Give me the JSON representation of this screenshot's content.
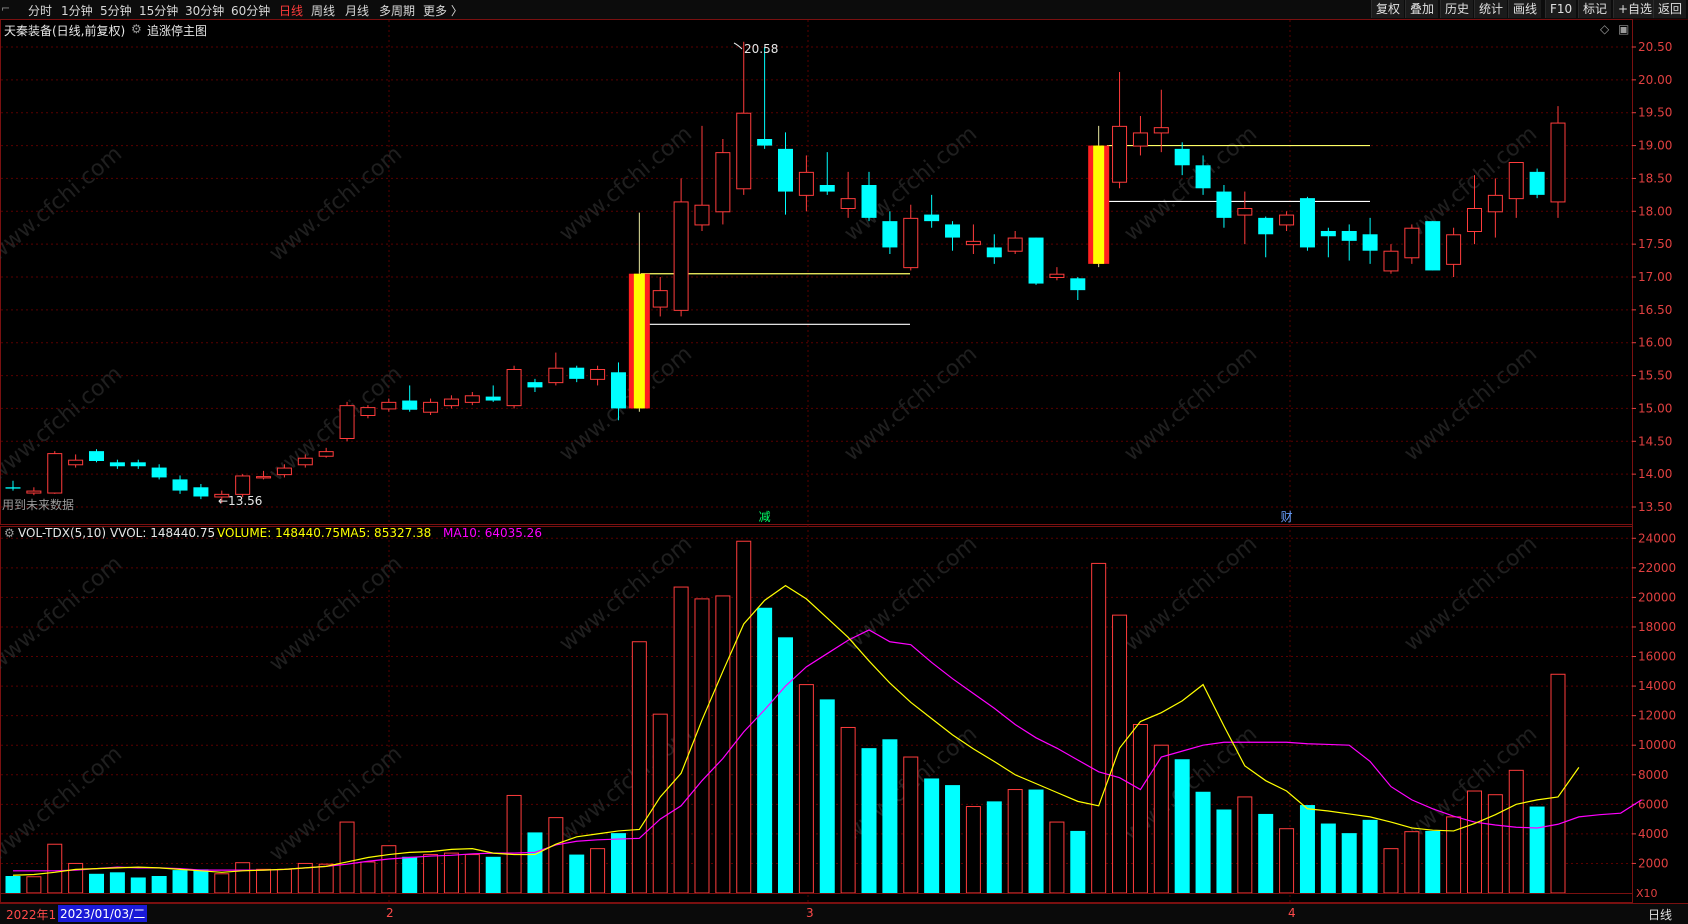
{
  "toolbar": {
    "period_tabs": [
      {
        "label": "分时",
        "active": false
      },
      {
        "label": "1分钟",
        "active": false
      },
      {
        "label": "5分钟",
        "active": false
      },
      {
        "label": "15分钟",
        "active": false
      },
      {
        "label": "30分钟",
        "active": false
      },
      {
        "label": "60分钟",
        "active": false
      },
      {
        "label": "日线",
        "active": true
      },
      {
        "label": "周线",
        "active": false
      },
      {
        "label": "月线",
        "active": false
      },
      {
        "label": "多周期",
        "active": false
      },
      {
        "label": "更多 〉",
        "active": false
      }
    ],
    "right_buttons": [
      "复权",
      "叠加",
      "历史",
      "统计",
      "画线",
      "F10",
      "标记",
      "+自选",
      "返回"
    ]
  },
  "main_chart": {
    "stock_title": "天秦装备(日线,前复权)",
    "indicator_label": "追涨停主图",
    "high_annotation": "20.58",
    "low_annotation": "←13.56",
    "future_data_note": "用到未来数据",
    "event_markers": [
      {
        "text": "减",
        "date_index": 36
      },
      {
        "text": "财",
        "date_index": 61
      }
    ],
    "price_axis_ticks": [
      "20.50",
      "20.00",
      "19.50",
      "19.00",
      "18.50",
      "18.00",
      "17.50",
      "17.00",
      "16.50",
      "16.00",
      "15.50",
      "15.00",
      "14.50",
      "14.00",
      "13.50"
    ]
  },
  "volume_chart": {
    "title": "VOL-TDX(5,10)",
    "vvol": "VVOL: 148440.75",
    "volume": "VOLUME: 148440.75",
    "ma5": "MA5: 85327.38",
    "ma10": "MA10: 64035.26",
    "axis_ticks": [
      "24000",
      "22000",
      "20000",
      "18000",
      "16000",
      "14000",
      "12000",
      "10000",
      "8000",
      "6000",
      "4000",
      "2000"
    ],
    "unit_label": "X10"
  },
  "watermark": "www.cfchi.com",
  "colors": {
    "up": "#ff3c3c",
    "down": "#00ffff",
    "limit_up_fill": "#ffff00",
    "ma5": "#ffff00",
    "ma10": "#ff00ff",
    "grid": "#5a0000",
    "level_yellow": "#ffff66",
    "level_white": "#ffffff"
  },
  "bottom_bar": {
    "left_date": "2022年1",
    "selected_date": "2023/01/03/二",
    "month_labels": [
      "2",
      "3",
      "4"
    ],
    "period_label": "日线"
  },
  "chart_data": {
    "type": "candlestick",
    "price_ylim": [
      13.3,
      20.7
    ],
    "candles": [
      {
        "o": 13.8,
        "h": 13.9,
        "l": 13.75,
        "c": 13.78
      },
      {
        "o": 13.72,
        "h": 13.8,
        "l": 13.68,
        "c": 13.75
      },
      {
        "o": 13.72,
        "h": 14.35,
        "l": 13.7,
        "c": 14.32
      },
      {
        "o": 14.15,
        "h": 14.3,
        "l": 14.1,
        "c": 14.22
      },
      {
        "o": 14.35,
        "h": 14.38,
        "l": 14.18,
        "c": 14.2
      },
      {
        "o": 14.18,
        "h": 14.22,
        "l": 14.08,
        "c": 14.12
      },
      {
        "o": 14.18,
        "h": 14.22,
        "l": 14.08,
        "c": 14.12
      },
      {
        "o": 14.1,
        "h": 14.15,
        "l": 13.92,
        "c": 13.95
      },
      {
        "o": 13.92,
        "h": 13.98,
        "l": 13.7,
        "c": 13.75
      },
      {
        "o": 13.8,
        "h": 13.85,
        "l": 13.62,
        "c": 13.66
      },
      {
        "o": 13.66,
        "h": 13.75,
        "l": 13.56,
        "c": 13.7
      },
      {
        "o": 13.7,
        "h": 14.0,
        "l": 13.65,
        "c": 13.98
      },
      {
        "o": 13.95,
        "h": 14.05,
        "l": 13.92,
        "c": 13.97
      },
      {
        "o": 14.0,
        "h": 14.15,
        "l": 13.95,
        "c": 14.1
      },
      {
        "o": 14.15,
        "h": 14.3,
        "l": 14.1,
        "c": 14.25
      },
      {
        "o": 14.28,
        "h": 14.4,
        "l": 14.25,
        "c": 14.35
      },
      {
        "o": 14.55,
        "h": 15.1,
        "l": 14.5,
        "c": 15.05
      },
      {
        "o": 14.9,
        "h": 15.05,
        "l": 14.85,
        "c": 15.02
      },
      {
        "o": 15.0,
        "h": 15.15,
        "l": 14.95,
        "c": 15.1
      },
      {
        "o": 15.12,
        "h": 15.35,
        "l": 14.95,
        "c": 14.98
      },
      {
        "o": 14.95,
        "h": 15.15,
        "l": 14.9,
        "c": 15.1
      },
      {
        "o": 15.05,
        "h": 15.2,
        "l": 15.0,
        "c": 15.15
      },
      {
        "o": 15.1,
        "h": 15.25,
        "l": 15.05,
        "c": 15.2
      },
      {
        "o": 15.18,
        "h": 15.35,
        "l": 15.1,
        "c": 15.12
      },
      {
        "o": 15.05,
        "h": 15.65,
        "l": 15.0,
        "c": 15.6
      },
      {
        "o": 15.4,
        "h": 15.45,
        "l": 15.25,
        "c": 15.32
      },
      {
        "o": 15.4,
        "h": 15.85,
        "l": 15.35,
        "c": 15.62
      },
      {
        "o": 15.62,
        "h": 15.65,
        "l": 15.4,
        "c": 15.45
      },
      {
        "o": 15.45,
        "h": 15.65,
        "l": 15.35,
        "c": 15.6
      },
      {
        "o": 15.55,
        "h": 15.7,
        "l": 14.82,
        "c": 15.0
      },
      {
        "o": 15.0,
        "h": 17.98,
        "l": 14.95,
        "c": 17.05,
        "limit": true
      },
      {
        "o": 16.55,
        "h": 17.0,
        "l": 16.4,
        "c": 16.8
      },
      {
        "o": 16.5,
        "h": 18.5,
        "l": 16.4,
        "c": 18.15
      },
      {
        "o": 17.8,
        "h": 19.3,
        "l": 17.7,
        "c": 18.1
      },
      {
        "o": 18.0,
        "h": 19.1,
        "l": 17.8,
        "c": 18.9
      },
      {
        "o": 18.35,
        "h": 20.58,
        "l": 18.25,
        "c": 19.5
      },
      {
        "o": 19.1,
        "h": 20.5,
        "l": 18.95,
        "c": 19.0
      },
      {
        "o": 18.95,
        "h": 19.2,
        "l": 17.95,
        "c": 18.3
      },
      {
        "o": 18.25,
        "h": 18.85,
        "l": 18.0,
        "c": 18.6
      },
      {
        "o": 18.4,
        "h": 18.9,
        "l": 18.25,
        "c": 18.3
      },
      {
        "o": 18.05,
        "h": 18.6,
        "l": 17.9,
        "c": 18.2
      },
      {
        "o": 18.4,
        "h": 18.6,
        "l": 17.85,
        "c": 17.9
      },
      {
        "o": 17.85,
        "h": 18.0,
        "l": 17.35,
        "c": 17.45
      },
      {
        "o": 17.15,
        "h": 18.1,
        "l": 17.1,
        "c": 17.9
      },
      {
        "o": 17.95,
        "h": 18.25,
        "l": 17.75,
        "c": 17.85
      },
      {
        "o": 17.8,
        "h": 17.85,
        "l": 17.4,
        "c": 17.6
      },
      {
        "o": 17.5,
        "h": 17.8,
        "l": 17.35,
        "c": 17.55
      },
      {
        "o": 17.45,
        "h": 17.65,
        "l": 17.2,
        "c": 17.3
      },
      {
        "o": 17.4,
        "h": 17.7,
        "l": 17.35,
        "c": 17.6
      },
      {
        "o": 17.6,
        "h": 17.6,
        "l": 16.88,
        "c": 16.9
      },
      {
        "o": 17.0,
        "h": 17.15,
        "l": 16.95,
        "c": 17.05
      },
      {
        "o": 16.98,
        "h": 17.0,
        "l": 16.65,
        "c": 16.8
      },
      {
        "o": 17.2,
        "h": 19.3,
        "l": 17.15,
        "c": 19.0,
        "limit": true
      },
      {
        "o": 18.45,
        "h": 20.12,
        "l": 18.35,
        "c": 19.3
      },
      {
        "o": 19.0,
        "h": 19.45,
        "l": 18.85,
        "c": 19.2
      },
      {
        "o": 19.2,
        "h": 19.85,
        "l": 18.9,
        "c": 19.28
      },
      {
        "o": 18.95,
        "h": 19.05,
        "l": 18.55,
        "c": 18.7
      },
      {
        "o": 18.7,
        "h": 18.85,
        "l": 18.25,
        "c": 18.35
      },
      {
        "o": 18.3,
        "h": 18.4,
        "l": 17.75,
        "c": 17.9
      },
      {
        "o": 17.95,
        "h": 18.3,
        "l": 17.5,
        "c": 18.05
      },
      {
        "o": 17.9,
        "h": 17.92,
        "l": 17.3,
        "c": 17.65
      },
      {
        "o": 17.8,
        "h": 18.0,
        "l": 17.7,
        "c": 17.95
      },
      {
        "o": 18.2,
        "h": 18.22,
        "l": 17.4,
        "c": 17.45
      },
      {
        "o": 17.7,
        "h": 17.75,
        "l": 17.3,
        "c": 17.62
      },
      {
        "o": 17.7,
        "h": 17.8,
        "l": 17.25,
        "c": 17.55
      },
      {
        "o": 17.65,
        "h": 17.9,
        "l": 17.2,
        "c": 17.4
      },
      {
        "o": 17.1,
        "h": 17.5,
        "l": 17.05,
        "c": 17.4
      },
      {
        "o": 17.3,
        "h": 17.8,
        "l": 17.2,
        "c": 17.75
      },
      {
        "o": 17.85,
        "h": 17.85,
        "l": 17.1,
        "c": 17.1
      },
      {
        "o": 17.2,
        "h": 17.75,
        "l": 17.0,
        "c": 17.65
      },
      {
        "o": 17.7,
        "h": 18.55,
        "l": 17.5,
        "c": 18.05
      },
      {
        "o": 18.0,
        "h": 18.5,
        "l": 17.6,
        "c": 18.25
      },
      {
        "o": 18.2,
        "h": 18.75,
        "l": 17.9,
        "c": 18.75
      },
      {
        "o": 18.6,
        "h": 18.65,
        "l": 18.2,
        "c": 18.25
      },
      {
        "o": 18.15,
        "h": 19.6,
        "l": 17.9,
        "c": 19.35
      }
    ],
    "volumes": [
      1150,
      1100,
      3300,
      2000,
      1300,
      1400,
      1050,
      1150,
      1550,
      1600,
      1300,
      2050,
      1600,
      1600,
      2000,
      1950,
      4800,
      2100,
      3200,
      2450,
      2600,
      2700,
      2600,
      2450,
      6600,
      4100,
      5100,
      2600,
      3000,
      4050,
      17000,
      12100,
      20700,
      19900,
      20100,
      23800,
      19300,
      17300,
      14100,
      13100,
      11200,
      9800,
      10400,
      9200,
      7750,
      7300,
      5850,
      6200,
      7000,
      7000,
      4800,
      4200,
      22300,
      18800,
      11400,
      10000,
      9050,
      6850,
      5650,
      6500,
      5350,
      4350,
      5950,
      4700,
      4050,
      4950,
      3000,
      4150,
      4200,
      5150,
      6900,
      6650,
      8300,
      5850,
      14800
    ],
    "ma5": [
      1200,
      1250,
      1400,
      1600,
      1650,
      1700,
      1750,
      1700,
      1600,
      1500,
      1400,
      1500,
      1550,
      1600,
      1700,
      1800,
      2100,
      2400,
      2600,
      2750,
      2800,
      2950,
      3000,
      2700,
      2600,
      2600,
      3300,
      3800,
      4000,
      4200,
      4300,
      6500,
      8100,
      11700,
      15000,
      18200,
      19800,
      20800,
      19900,
      18600,
      17300,
      15700,
      14200,
      12900,
      11800,
      10700,
      9750,
      8900,
      8000,
      7400,
      6800,
      6200,
      5900,
      9800,
      11600,
      12200,
      13000,
      14100,
      11300,
      8600,
      7600,
      6900,
      5700,
      5550,
      5350,
      5150,
      4800,
      4400,
      4250,
      4200,
      4700,
      5300,
      6000,
      6300,
      6500,
      8500
    ],
    "ma10": [
      1500,
      1500,
      1500,
      1550,
      1650,
      1750,
      1700,
      1700,
      1650,
      1550,
      1550,
      1550,
      1550,
      1600,
      1700,
      1800,
      1950,
      2150,
      2300,
      2400,
      2500,
      2550,
      2650,
      2700,
      2700,
      2750,
      3250,
      3500,
      3600,
      3650,
      3700,
      5000,
      5900,
      7600,
      9100,
      10900,
      12400,
      14000,
      15300,
      16200,
      17100,
      17800,
      17000,
      16800,
      15600,
      14500,
      13500,
      12500,
      11400,
      10500,
      9800,
      9000,
      8200,
      7800,
      7000,
      9200,
      9600,
      10000,
      10200,
      10200,
      10200,
      10200,
      10100,
      10050,
      10000,
      8900,
      7200,
      6300,
      5700,
      5200,
      4800,
      4600,
      4450,
      4400,
      4650,
      5150,
      5300,
      5400,
      6300
    ]
  }
}
